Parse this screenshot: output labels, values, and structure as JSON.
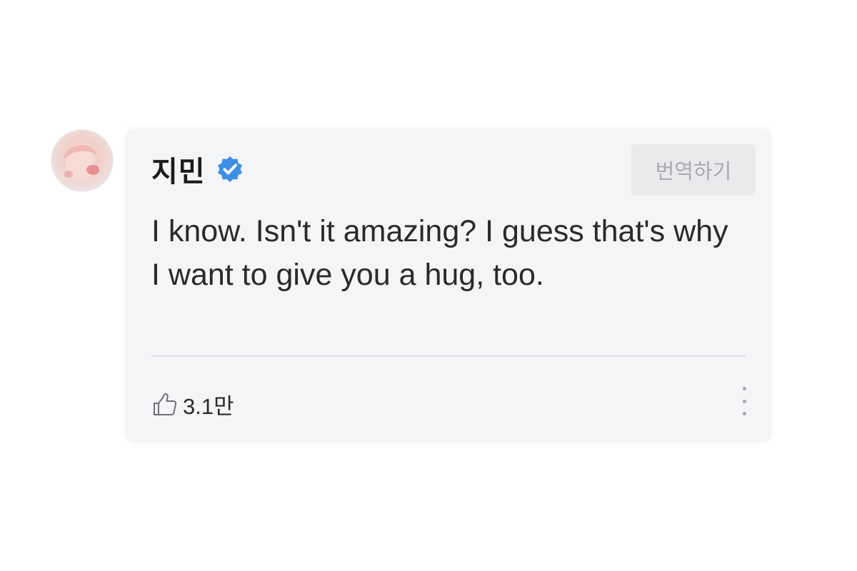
{
  "post": {
    "author_name": "지민",
    "verified": true,
    "translate_label": "번역하기",
    "message": "I know. Isn't it amazing? I guess that's why I want to give you a hug, too.",
    "like_count": "3.1만"
  },
  "icons": {
    "verified": "verified-badge-icon",
    "like": "thumbs-up-icon",
    "more": "more-vertical-icon",
    "avatar": "avatar"
  },
  "colors": {
    "verified_badge": "#3d8fe6",
    "card_background": "#f4f5f7",
    "translate_button_bg": "#e9eaec"
  }
}
